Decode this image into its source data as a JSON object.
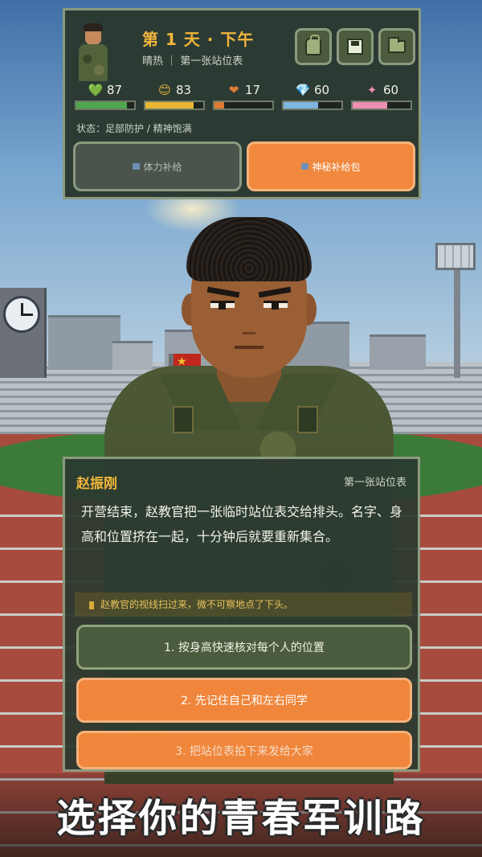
{
  "hud": {
    "day_title": "第 1 天 · 下午",
    "weather": "晴热 ｜ 第一张站位表",
    "status_text": "状态：足部防护 / 精神饱满",
    "buttons": [
      {
        "icon": "backpack-icon"
      },
      {
        "icon": "save-disk-icon"
      },
      {
        "icon": "folder-icon"
      }
    ],
    "stats": [
      {
        "icon": "heart-icon",
        "glyph": "💚",
        "value": "87",
        "fill": 0.87,
        "color": "#4fa64d"
      },
      {
        "icon": "smile-icon",
        "glyph": "😊",
        "value": "83",
        "fill": 0.83,
        "color": "#e8b834"
      },
      {
        "icon": "muscle-icon",
        "glyph": "❤",
        "value": "17",
        "fill": 0.17,
        "color": "#e07a34"
      },
      {
        "icon": "diamond-icon",
        "glyph": "💎",
        "value": "60",
        "fill": 0.6,
        "color": "#7fb6e0"
      },
      {
        "icon": "sparkle-icon",
        "glyph": "✦",
        "value": "60",
        "fill": 0.6,
        "color": "#ec8fb2"
      }
    ],
    "action_left_label": "体力补给",
    "action_right_label": "神秘补给包"
  },
  "dialog": {
    "speaker": "赵振刚",
    "chapter": "第一张站位表",
    "story": "开营结束，赵教官把一张临时站位表交给排头。名字、身高和位置挤在一起，十分钟后就要重新集合。",
    "hint": "赵教官的视线扫过来，微不可察地点了下头。",
    "choices": [
      "1. 按身高快速核对每个人的位置",
      "2. 先记住自己和左右同学",
      "3. 把站位表拍下来发给大家"
    ]
  },
  "caption": "选择你的青春军训路"
}
